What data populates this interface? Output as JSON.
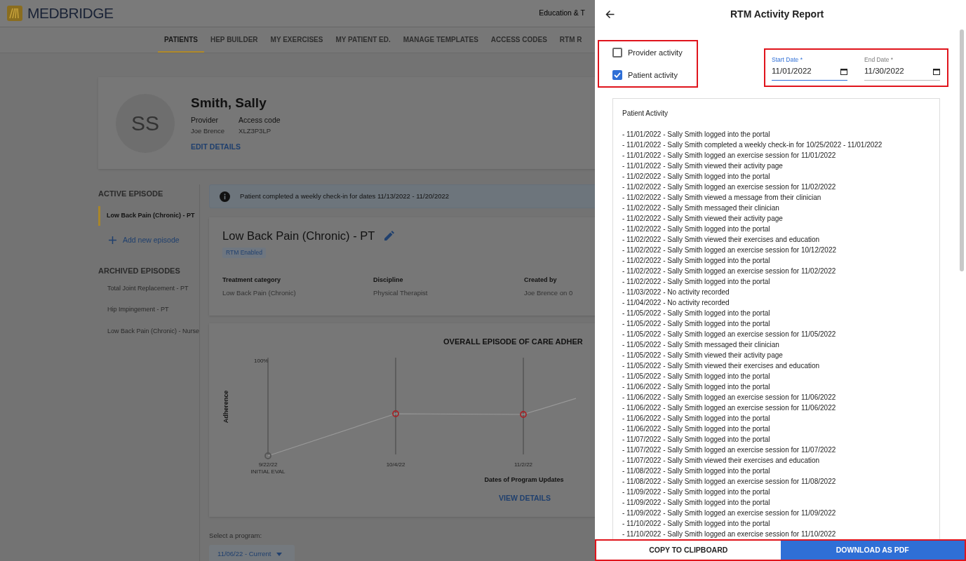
{
  "header": {
    "logo": "MEDBRIDGE",
    "account": "Education & T"
  },
  "nav": [
    {
      "label": "PATIENTS",
      "selected": true
    },
    {
      "label": "HEP BUILDER",
      "selected": false
    },
    {
      "label": "MY EXERCISES",
      "selected": false
    },
    {
      "label": "MY PATIENT ED.",
      "selected": false
    },
    {
      "label": "MANAGE TEMPLATES",
      "selected": false
    },
    {
      "label": "ACCESS CODES",
      "selected": false
    },
    {
      "label": "RTM R",
      "selected": false
    }
  ],
  "patient": {
    "initials": "SS",
    "name": "Smith, Sally",
    "fields": [
      {
        "label": "Provider",
        "value": "Joe Brence"
      },
      {
        "label": "Access code",
        "value": "XLZ3P3LP"
      }
    ],
    "edit_link": "EDIT DETAILS"
  },
  "episodes": {
    "active_heading": "ACTIVE EPISODE",
    "active": [
      {
        "label": "Low Back Pain (Chronic) - PT",
        "selected": true
      }
    ],
    "add_link": "Add new episode",
    "archived_heading": "ARCHIVED EPISODES",
    "archived": [
      {
        "label": "Total Joint Replacement - PT",
        "selected": false
      },
      {
        "label": "Hip Impingement - PT",
        "selected": false
      },
      {
        "label": "Low Back Pain (Chronic) - Nurse",
        "selected": false
      }
    ]
  },
  "banner": "Patient completed a weekly check-in for dates 11/13/2022 - 11/20/2022",
  "episode": {
    "title": "Low Back Pain (Chronic) - PT",
    "badge": "RTM Enabled",
    "details": [
      {
        "label": "Treatment category",
        "value": "Low Back Pain (Chronic)"
      },
      {
        "label": "Discipline",
        "value": "Physical Therapist"
      },
      {
        "label": "Created by",
        "value": "Joe Brence on 0"
      }
    ]
  },
  "chart": {
    "title": "OVERALL EPISODE OF CARE ADHER",
    "y_tick": "100%",
    "ylabel": "Adherence",
    "x_labels": [
      {
        "date": "9/22/22",
        "sub": "INITIAL EVAL"
      },
      {
        "date": "10/4/22"
      },
      {
        "date": "11/2/22"
      }
    ],
    "xlabel": "Dates of Program Updates",
    "link": "VIEW DETAILS"
  },
  "program": {
    "label": "Select a program:",
    "value": "11/06/22 - Current"
  },
  "report": {
    "title": "RTM Activity Report",
    "options": [
      {
        "label": "Provider activity",
        "checked": false
      },
      {
        "label": "Patient activity",
        "checked": true
      }
    ],
    "dates": [
      {
        "label": "Start Date *",
        "value": "11/01/2022",
        "focused": true
      },
      {
        "label": "End Date *",
        "value": "11/30/2022",
        "focused": false
      }
    ],
    "activity_heading": "Patient Activity",
    "activity": [
      "- 11/01/2022 - Sally Smith logged into the portal",
      "- 11/01/2022 - Sally Smith completed a weekly check-in for 10/25/2022 - 11/01/2022",
      "- 11/01/2022 - Sally Smith logged an exercise session for 11/01/2022",
      "- 11/01/2022 - Sally Smith viewed their activity page",
      "- 11/02/2022 - Sally Smith logged into the portal",
      "- 11/02/2022 - Sally Smith logged an exercise session for 11/02/2022",
      "- 11/02/2022 - Sally Smith viewed a message from their clinician",
      "- 11/02/2022 - Sally Smith messaged their clinician",
      "- 11/02/2022 - Sally Smith viewed their activity page",
      "- 11/02/2022 - Sally Smith logged into the portal",
      "- 11/02/2022 - Sally Smith viewed their exercises and education",
      "- 11/02/2022 - Sally Smith logged an exercise session for 10/12/2022",
      "- 11/02/2022 - Sally Smith logged into the portal",
      "- 11/02/2022 - Sally Smith logged an exercise session for 11/02/2022",
      "- 11/02/2022 - Sally Smith logged into the portal",
      "- 11/03/2022 - No activity recorded",
      "- 11/04/2022 - No activity recorded",
      "- 11/05/2022 - Sally Smith logged into the portal",
      "- 11/05/2022 - Sally Smith logged into the portal",
      "- 11/05/2022 - Sally Smith logged an exercise session for 11/05/2022",
      "- 11/05/2022 - Sally Smith messaged their clinician",
      "- 11/05/2022 - Sally Smith viewed their activity page",
      "- 11/05/2022 - Sally Smith viewed their exercises and education",
      "- 11/05/2022 - Sally Smith logged into the portal",
      "- 11/06/2022 - Sally Smith logged into the portal",
      "- 11/06/2022 - Sally Smith logged an exercise session for 11/06/2022",
      "- 11/06/2022 - Sally Smith logged an exercise session for 11/06/2022",
      "- 11/06/2022 - Sally Smith logged into the portal",
      "- 11/06/2022 - Sally Smith logged into the portal",
      "- 11/07/2022 - Sally Smith logged into the portal",
      "- 11/07/2022 - Sally Smith logged an exercise session for 11/07/2022",
      "- 11/07/2022 - Sally Smith viewed their exercises and education",
      "- 11/08/2022 - Sally Smith logged into the portal",
      "- 11/08/2022 - Sally Smith logged an exercise session for 11/08/2022",
      "- 11/09/2022 - Sally Smith logged into the portal",
      "- 11/09/2022 - Sally Smith logged into the portal",
      "- 11/09/2022 - Sally Smith logged an exercise session for 11/09/2022",
      "- 11/10/2022 - Sally Smith logged into the portal",
      "- 11/10/2022 - Sally Smith logged an exercise session for 11/10/2022"
    ],
    "buttons": [
      {
        "label": "COPY TO CLIPBOARD",
        "kind": "outline"
      },
      {
        "label": "DOWNLOAD AS PDF",
        "kind": "primary"
      }
    ]
  }
}
